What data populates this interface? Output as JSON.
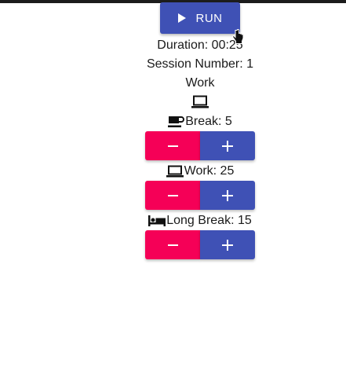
{
  "run_button": {
    "label": "RUN",
    "icon": "play-icon"
  },
  "status": {
    "duration": "Duration: 00:25",
    "session": "Session Number: 1",
    "mode": "Work",
    "mode_icon": "laptop-icon"
  },
  "settings": [
    {
      "icon": "coffee-icon",
      "label": "Break: 5"
    },
    {
      "icon": "laptop-icon",
      "label": "Work: 25"
    },
    {
      "icon": "bed-icon",
      "label": "Long Break: 15"
    }
  ],
  "colors": {
    "primary": "#3f51b5",
    "secondary": "#f50057"
  }
}
